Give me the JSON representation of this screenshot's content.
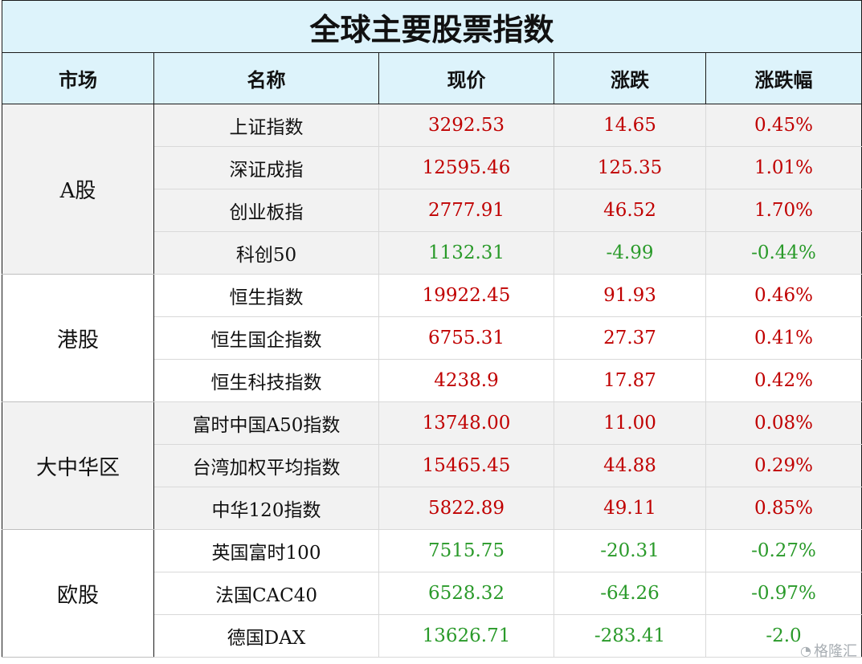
{
  "title": "全球主要股票指数",
  "headers": {
    "market": "市场",
    "name": "名称",
    "price": "现价",
    "change": "涨跌",
    "pct": "涨跌幅"
  },
  "colors": {
    "up": "#c00000",
    "down": "#2a9a2a",
    "header_bg": "#ddf3fb",
    "shade_bg": "#f2f2f2"
  },
  "groups": [
    {
      "market": "A股",
      "rows": [
        {
          "name": "上证指数",
          "price": "3292.53",
          "change": "14.65",
          "pct": "0.45%",
          "dir": "up"
        },
        {
          "name": "深证成指",
          "price": "12595.46",
          "change": "125.35",
          "pct": "1.01%",
          "dir": "up"
        },
        {
          "name": "创业板指",
          "price": "2777.91",
          "change": "46.52",
          "pct": "1.70%",
          "dir": "up"
        },
        {
          "name": "科创50",
          "price": "1132.31",
          "change": "-4.99",
          "pct": "-0.44%",
          "dir": "down"
        }
      ]
    },
    {
      "market": "港股",
      "rows": [
        {
          "name": "恒生指数",
          "price": "19922.45",
          "change": "91.93",
          "pct": "0.46%",
          "dir": "up"
        },
        {
          "name": "恒生国企指数",
          "price": "6755.31",
          "change": "27.37",
          "pct": "0.41%",
          "dir": "up"
        },
        {
          "name": "恒生科技指数",
          "price": "4238.9",
          "change": "17.87",
          "pct": "0.42%",
          "dir": "up"
        }
      ]
    },
    {
      "market": "大中华区",
      "rows": [
        {
          "name": "富时中国A50指数",
          "price": "13748.00",
          "change": "11.00",
          "pct": "0.08%",
          "dir": "up"
        },
        {
          "name": "台湾加权平均指数",
          "price": "15465.45",
          "change": "44.88",
          "pct": "0.29%",
          "dir": "up"
        },
        {
          "name": "中华120指数",
          "price": "5822.89",
          "change": "49.11",
          "pct": "0.85%",
          "dir": "up"
        }
      ]
    },
    {
      "market": "欧股",
      "rows": [
        {
          "name": "英国富时100",
          "price": "7515.75",
          "change": "-20.31",
          "pct": "-0.27%",
          "dir": "down"
        },
        {
          "name": "法国CAC40",
          "price": "6528.32",
          "change": "-64.26",
          "pct": "-0.97%",
          "dir": "down"
        },
        {
          "name": "德国DAX",
          "price": "13626.71",
          "change": "-283.41",
          "pct": "-2.0",
          "dir": "down"
        }
      ]
    }
  ],
  "watermark": "格隆汇"
}
